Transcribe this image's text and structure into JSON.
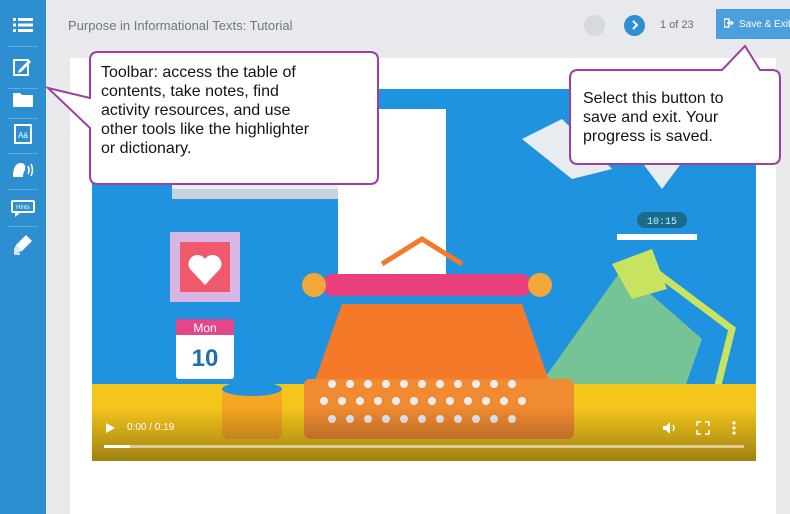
{
  "header": {
    "title": "Purpose in Informational Texts: Tutorial",
    "page_current": 1,
    "page_total": 23,
    "page_separator": "of",
    "save_exit_label": "Save & Exit"
  },
  "sidebar": {
    "items": [
      {
        "icon": "table-of-contents-icon"
      },
      {
        "icon": "notes-icon"
      },
      {
        "icon": "folder-icon"
      },
      {
        "icon": "dictionary-icon",
        "glyph": "Aä"
      },
      {
        "icon": "read-aloud-icon"
      },
      {
        "icon": "hints-icon",
        "glyph": "Hints"
      },
      {
        "icon": "highlighter-icon"
      }
    ]
  },
  "video": {
    "time_display": "0:00 / 0:19",
    "progress_fraction": 0.04,
    "calendar_day": "Mon",
    "calendar_date": "10",
    "clock_display": "10:15"
  },
  "callouts": {
    "toolbar": [
      "Toolbar: access the table of",
      "contents, take notes, find",
      "activity resources, and use",
      "other tools like the highlighter",
      "or dictionary."
    ],
    "save": [
      "Select this button to",
      "save and exit. Your",
      "progress is saved."
    ]
  },
  "colors": {
    "sidebar": "#2d8fd0",
    "accent": "#4a9fdc",
    "callout_border": "#9c3fa0",
    "video_bg": "#1f93e0"
  }
}
